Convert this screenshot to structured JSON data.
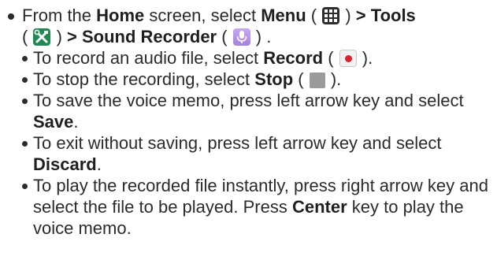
{
  "main_item": {
    "pre": "From the ",
    "home": "Home",
    "mid1": " screen, select ",
    "menu": "Menu",
    "paren_open1": " ( ",
    "paren_close1": " ) ",
    "tools": "> Tools",
    "paren_open2": "( ",
    "paren_close2": " ) ",
    "sound_recorder": "> Sound Recorder",
    "paren_open3": " ( ",
    "paren_close3": " ) ."
  },
  "sub_items": [
    {
      "pre": "To record an audio file, select ",
      "bold": "Record",
      "open": " ( ",
      "icon": "record-icon",
      "close": " )."
    },
    {
      "pre": "To stop the recording, select ",
      "bold": "Stop",
      "open": " ( ",
      "icon": "stop-icon",
      "close": " )."
    },
    {
      "pre": "To save the voice memo, press left arrow key and select ",
      "bold": "Save",
      "post": "."
    },
    {
      "pre": "To exit without saving, press left arrow key and select ",
      "bold": "Discard",
      "post": "."
    },
    {
      "pre": "To play the recorded file instantly, press right arrow key and select the file to be played. Press ",
      "bold": "Center",
      "post": " key to play the voice memo."
    }
  ],
  "icons": {
    "menu": "grid-menu-icon",
    "tools": "tools-icon",
    "sound_recorder": "microphone-icon"
  },
  "colors": {
    "tools_icon": "#1f8a4f",
    "mic_icon": "#a681e3",
    "record_dot": "#e0202e",
    "stop_square": "#9b9b9b"
  }
}
